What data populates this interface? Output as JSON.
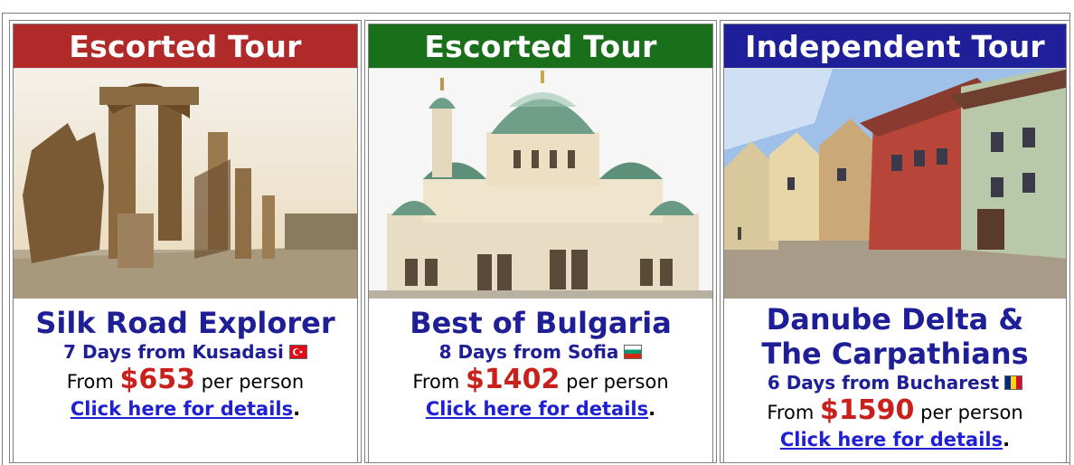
{
  "cards": [
    {
      "banner": "Escorted Tour",
      "banner_color": "#b02a2a",
      "title_lines": [
        "Silk Road Explorer"
      ],
      "subtitle": "7 Days from Kusadasi",
      "flag": "turkey-flag-icon",
      "from_label": "From",
      "price": "$653",
      "per_person": "per person",
      "link": "Click here for details",
      "link_suffix": "."
    },
    {
      "banner": "Escorted Tour",
      "banner_color": "#1a6f1a",
      "title_lines": [
        "Best of Bulgaria"
      ],
      "subtitle": "8 Days from Sofia",
      "flag": "bulgaria-flag-icon",
      "from_label": "From",
      "price": "$1402",
      "per_person": "per person",
      "link": "Click here for details",
      "link_suffix": "."
    },
    {
      "banner": "Independent Tour",
      "banner_color": "#1f1f9a",
      "title_lines": [
        "Danube Delta &",
        "The Carpathians"
      ],
      "subtitle": "6 Days from Bucharest",
      "flag": "romania-flag-icon",
      "from_label": "From",
      "price": "$1590",
      "per_person": "per person",
      "link": "Click here for details",
      "link_suffix": "."
    }
  ]
}
